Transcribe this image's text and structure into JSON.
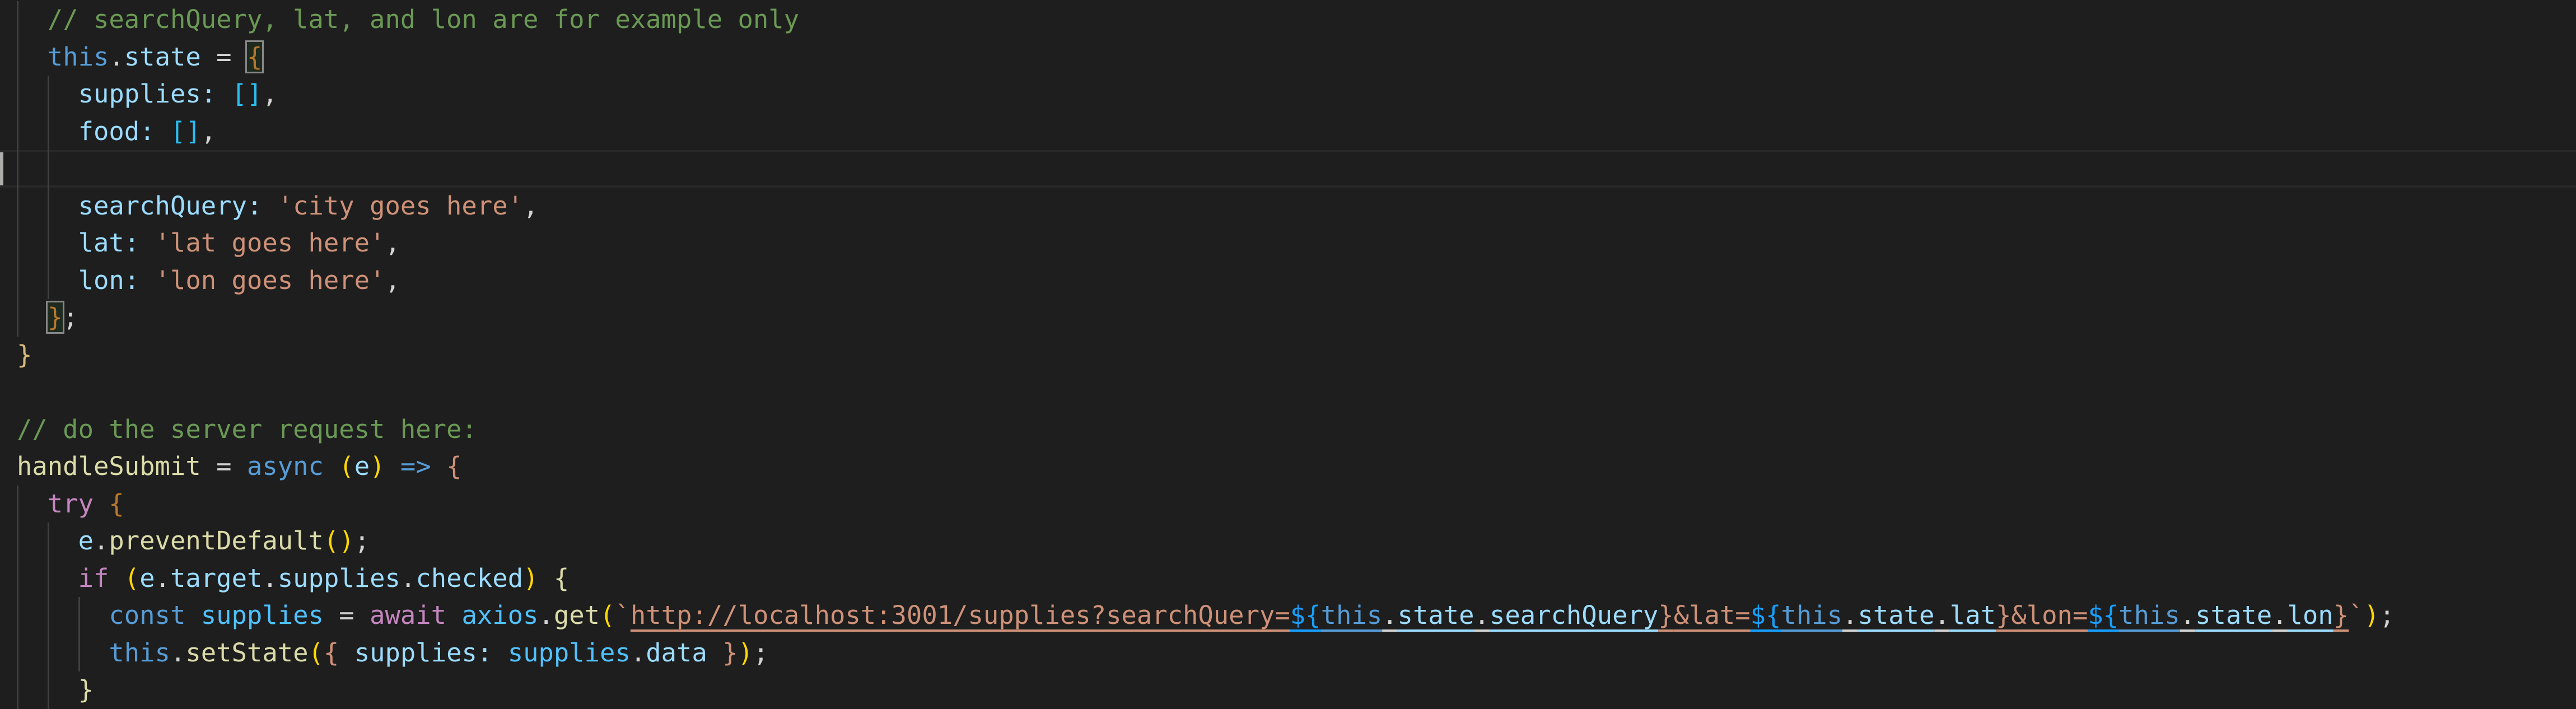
{
  "editor": {
    "colors": {
      "background": "#1e1e1e",
      "comment": "#6a9955",
      "keyword": "#569cd6",
      "property": "#9cdcfe",
      "string": "#ce9178"
    },
    "cursor_line": 5,
    "lines": [
      [
        [
          "  ",
          "o"
        ],
        [
          "// searchQuery, lat, and lon are for example only",
          "c"
        ]
      ],
      [
        [
          "  ",
          "o"
        ],
        [
          "this",
          "k"
        ],
        [
          ".",
          "o"
        ],
        [
          "state",
          "p"
        ],
        [
          " = ",
          "o"
        ],
        [
          "{",
          "b1 br"
        ]
      ],
      [
        [
          "    ",
          "o"
        ],
        [
          "supplies",
          "p"
        ],
        [
          ": ",
          "p"
        ],
        [
          "[]",
          "sq"
        ],
        [
          ",",
          "o"
        ]
      ],
      [
        [
          "    ",
          "o"
        ],
        [
          "food",
          "p"
        ],
        [
          ": ",
          "p"
        ],
        [
          "[]",
          "sq"
        ],
        [
          ",",
          "o"
        ]
      ],
      [],
      [
        [
          "    ",
          "o"
        ],
        [
          "searchQuery",
          "p"
        ],
        [
          ": ",
          "p"
        ],
        [
          "'city goes here'",
          "s"
        ],
        [
          ",",
          "o"
        ]
      ],
      [
        [
          "    ",
          "o"
        ],
        [
          "lat",
          "p"
        ],
        [
          ": ",
          "p"
        ],
        [
          "'lat goes here'",
          "s"
        ],
        [
          ",",
          "o"
        ]
      ],
      [
        [
          "    ",
          "o"
        ],
        [
          "lon",
          "p"
        ],
        [
          ": ",
          "p"
        ],
        [
          "'lon goes here'",
          "s"
        ],
        [
          ",",
          "o"
        ]
      ],
      [
        [
          "  ",
          "o"
        ],
        [
          "}",
          "b1 br"
        ],
        [
          ";",
          "o"
        ]
      ],
      [
        [
          "}",
          "b3"
        ]
      ],
      [],
      [
        [
          "// do the server request here:",
          "c"
        ]
      ],
      [
        [
          "handleSubmit",
          "f"
        ],
        [
          " = ",
          "o"
        ],
        [
          "async",
          "k"
        ],
        [
          " ",
          "o"
        ],
        [
          "(",
          "b2"
        ],
        [
          "e",
          "p"
        ],
        [
          ")",
          "b2"
        ],
        [
          " ",
          "o"
        ],
        [
          "=>",
          "k"
        ],
        [
          " ",
          "o"
        ],
        [
          "{",
          "s"
        ]
      ],
      [
        [
          "  ",
          "o"
        ],
        [
          "try",
          "kw"
        ],
        [
          " ",
          "o"
        ],
        [
          "{",
          "b1"
        ]
      ],
      [
        [
          "    ",
          "o"
        ],
        [
          "e",
          "p"
        ],
        [
          ".",
          "o"
        ],
        [
          "preventDefault",
          "f"
        ],
        [
          "(",
          "b2"
        ],
        [
          ")",
          "b2"
        ],
        [
          ";",
          "o"
        ]
      ],
      [
        [
          "    ",
          "o"
        ],
        [
          "if",
          "kw"
        ],
        [
          " ",
          "o"
        ],
        [
          "(",
          "b2"
        ],
        [
          "e",
          "p"
        ],
        [
          ".",
          "o"
        ],
        [
          "target",
          "p"
        ],
        [
          ".",
          "o"
        ],
        [
          "supplies",
          "p"
        ],
        [
          ".",
          "o"
        ],
        [
          "checked",
          "p"
        ],
        [
          ")",
          "b2"
        ],
        [
          " ",
          "o"
        ],
        [
          "{",
          "f"
        ]
      ],
      [
        [
          "      ",
          "o"
        ],
        [
          "const",
          "k"
        ],
        [
          " ",
          "o"
        ],
        [
          "supplies",
          "v"
        ],
        [
          " = ",
          "o"
        ],
        [
          "await",
          "kw"
        ],
        [
          " ",
          "o"
        ],
        [
          "axios",
          "v"
        ],
        [
          ".",
          "o"
        ],
        [
          "get",
          "f"
        ],
        [
          "(",
          "b2"
        ],
        [
          "`",
          "s"
        ],
        [
          "http://localhost:3001/supplies?searchQuery=",
          "s u"
        ],
        [
          "${",
          "tp u"
        ],
        [
          "this",
          "k u"
        ],
        [
          ".",
          "o u"
        ],
        [
          "state",
          "p u"
        ],
        [
          ".",
          "o u"
        ],
        [
          "searchQuery",
          "p u"
        ],
        [
          "}",
          "s u"
        ],
        [
          "&lat=",
          "s u"
        ],
        [
          "${",
          "tp u"
        ],
        [
          "this",
          "k u"
        ],
        [
          ".",
          "o u"
        ],
        [
          "state",
          "p u"
        ],
        [
          ".",
          "o u"
        ],
        [
          "lat",
          "p u"
        ],
        [
          "}",
          "s u"
        ],
        [
          "&lon=",
          "s u"
        ],
        [
          "${",
          "tp u"
        ],
        [
          "this",
          "k u"
        ],
        [
          ".",
          "o u"
        ],
        [
          "state",
          "p u"
        ],
        [
          ".",
          "o u"
        ],
        [
          "lon",
          "p u"
        ],
        [
          "}",
          "s u"
        ],
        [
          "`",
          "s"
        ],
        [
          ")",
          "b2"
        ],
        [
          ";",
          "o"
        ]
      ],
      [
        [
          "      ",
          "o"
        ],
        [
          "this",
          "k"
        ],
        [
          ".",
          "o"
        ],
        [
          "setState",
          "f"
        ],
        [
          "(",
          "b2"
        ],
        [
          "{",
          "s"
        ],
        [
          " ",
          "o"
        ],
        [
          "supplies",
          "p"
        ],
        [
          ": ",
          "p"
        ],
        [
          "supplies",
          "v"
        ],
        [
          ".",
          "o"
        ],
        [
          "data",
          "p"
        ],
        [
          " ",
          "o"
        ],
        [
          "}",
          "s"
        ],
        [
          ")",
          "b2"
        ],
        [
          ";",
          "o"
        ]
      ],
      [
        [
          "    ",
          "o"
        ],
        [
          "}",
          "f"
        ]
      ]
    ]
  }
}
